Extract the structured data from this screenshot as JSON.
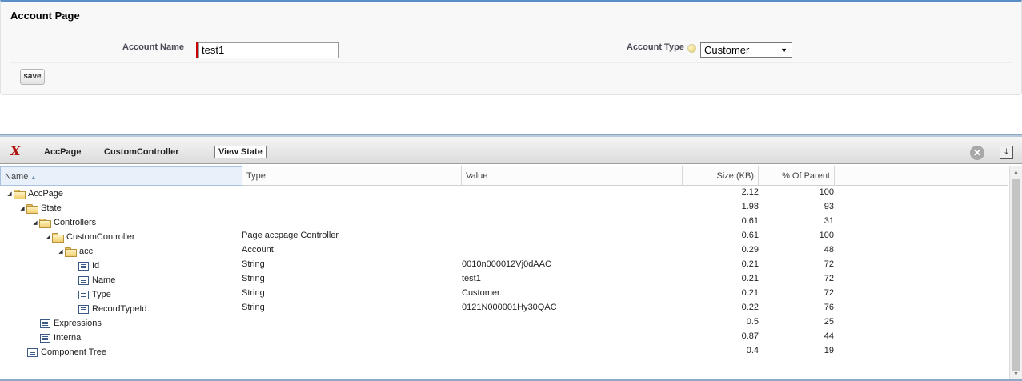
{
  "account_page": {
    "title": "Account Page",
    "account_name_label": "Account Name",
    "account_name_value": "test1",
    "account_type_label": "Account Type",
    "account_type_value": "Customer",
    "save_label": "save"
  },
  "dev_panel": {
    "logo": "X",
    "tabs": [
      "AccPage",
      "CustomController",
      "View State"
    ],
    "active_tab": "View State",
    "columns": {
      "name": "Name",
      "type": "Type",
      "value": "Value",
      "size": "Size (KB)",
      "pct": "% Of Parent"
    },
    "rows": [
      {
        "name": "AccPage",
        "level": 0,
        "icon": "folder-icon",
        "expanded": true,
        "type": "",
        "value": "",
        "size": "2.12",
        "pct": "100"
      },
      {
        "name": "State",
        "level": 1,
        "icon": "folder-icon",
        "expanded": true,
        "type": "",
        "value": "",
        "size": "1.98",
        "pct": "93"
      },
      {
        "name": "Controllers",
        "level": 2,
        "icon": "folder-icon",
        "expanded": true,
        "type": "",
        "value": "",
        "size": "0.61",
        "pct": "31"
      },
      {
        "name": "CustomController",
        "level": 3,
        "icon": "folder-icon",
        "expanded": true,
        "type": "Page accpage Controller",
        "value": "",
        "size": "0.61",
        "pct": "100"
      },
      {
        "name": "acc",
        "level": 4,
        "icon": "folder-icon",
        "expanded": true,
        "type": "Account",
        "value": "",
        "size": "0.29",
        "pct": "48"
      },
      {
        "name": "Id",
        "level": 5,
        "icon": "field-icon",
        "expanded": false,
        "type": "String",
        "value": "0010n000012Vj0dAAC",
        "size": "0.21",
        "pct": "72"
      },
      {
        "name": "Name",
        "level": 5,
        "icon": "field-icon",
        "expanded": false,
        "type": "String",
        "value": "test1",
        "size": "0.21",
        "pct": "72"
      },
      {
        "name": "Type",
        "level": 5,
        "icon": "field-icon",
        "expanded": false,
        "type": "String",
        "value": "Customer",
        "size": "0.21",
        "pct": "72"
      },
      {
        "name": "RecordTypeId",
        "level": 5,
        "icon": "field-icon",
        "expanded": false,
        "type": "String",
        "value": "0121N000001Hy30QAC",
        "size": "0.22",
        "pct": "76"
      },
      {
        "name": "Expressions",
        "level": 2,
        "icon": "field-icon",
        "expanded": false,
        "type": "",
        "value": "",
        "size": "0.5",
        "pct": "25"
      },
      {
        "name": "Internal",
        "level": 2,
        "icon": "field-icon",
        "expanded": false,
        "type": "",
        "value": "",
        "size": "0.87",
        "pct": "44"
      },
      {
        "name": "Component Tree",
        "level": 1,
        "icon": "field-icon",
        "expanded": false,
        "type": "",
        "value": "",
        "size": "0.4",
        "pct": "19"
      }
    ]
  }
}
